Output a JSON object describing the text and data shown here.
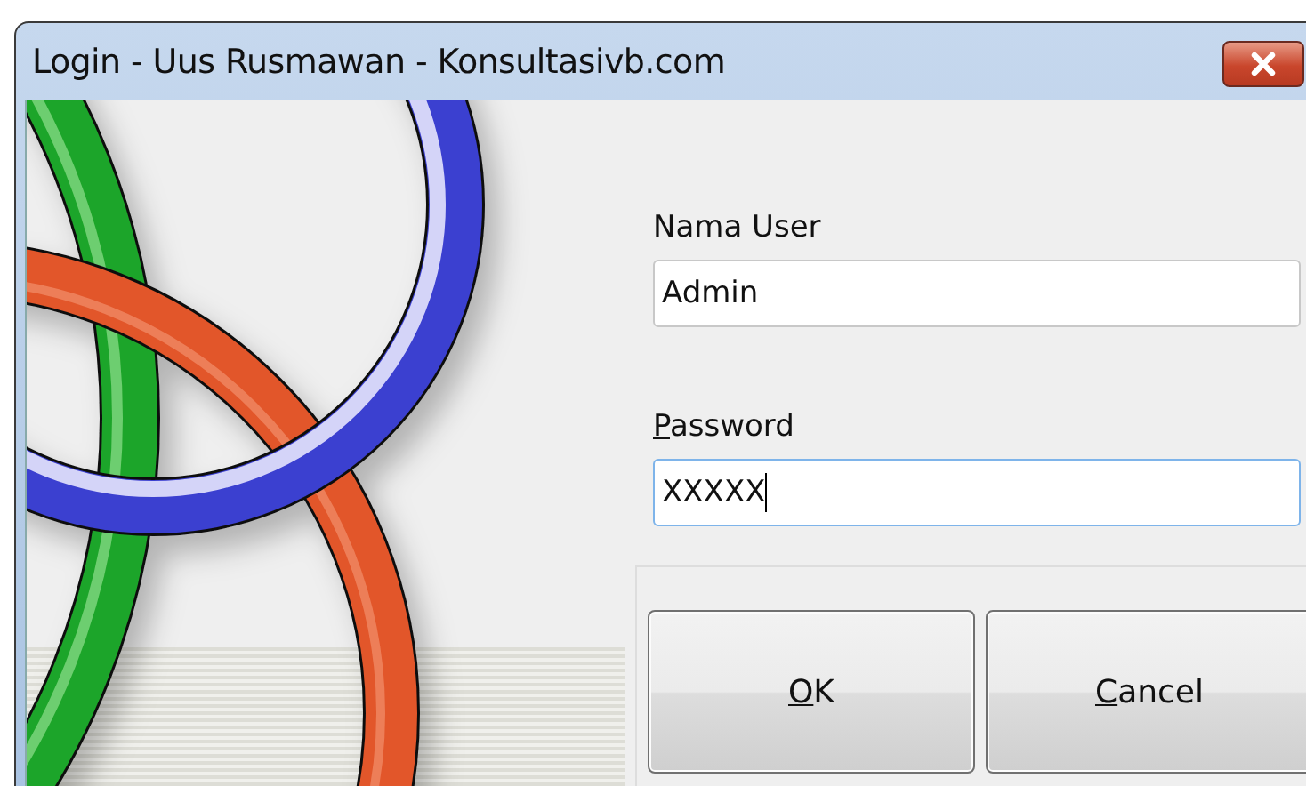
{
  "window": {
    "title": "Login - Uus Rusmawan - Konsultasivb.com"
  },
  "fields": [
    {
      "label": "Nama User",
      "first_letter_underlined": false,
      "value": "Admin",
      "focused": false
    },
    {
      "label": "Password",
      "first_letter_underlined": true,
      "value": "XXXXX",
      "focused": true
    }
  ],
  "buttons": [
    {
      "label": "OK",
      "first_letter_underlined": true
    },
    {
      "label": "Cancel",
      "first_letter_underlined": true
    }
  ]
}
